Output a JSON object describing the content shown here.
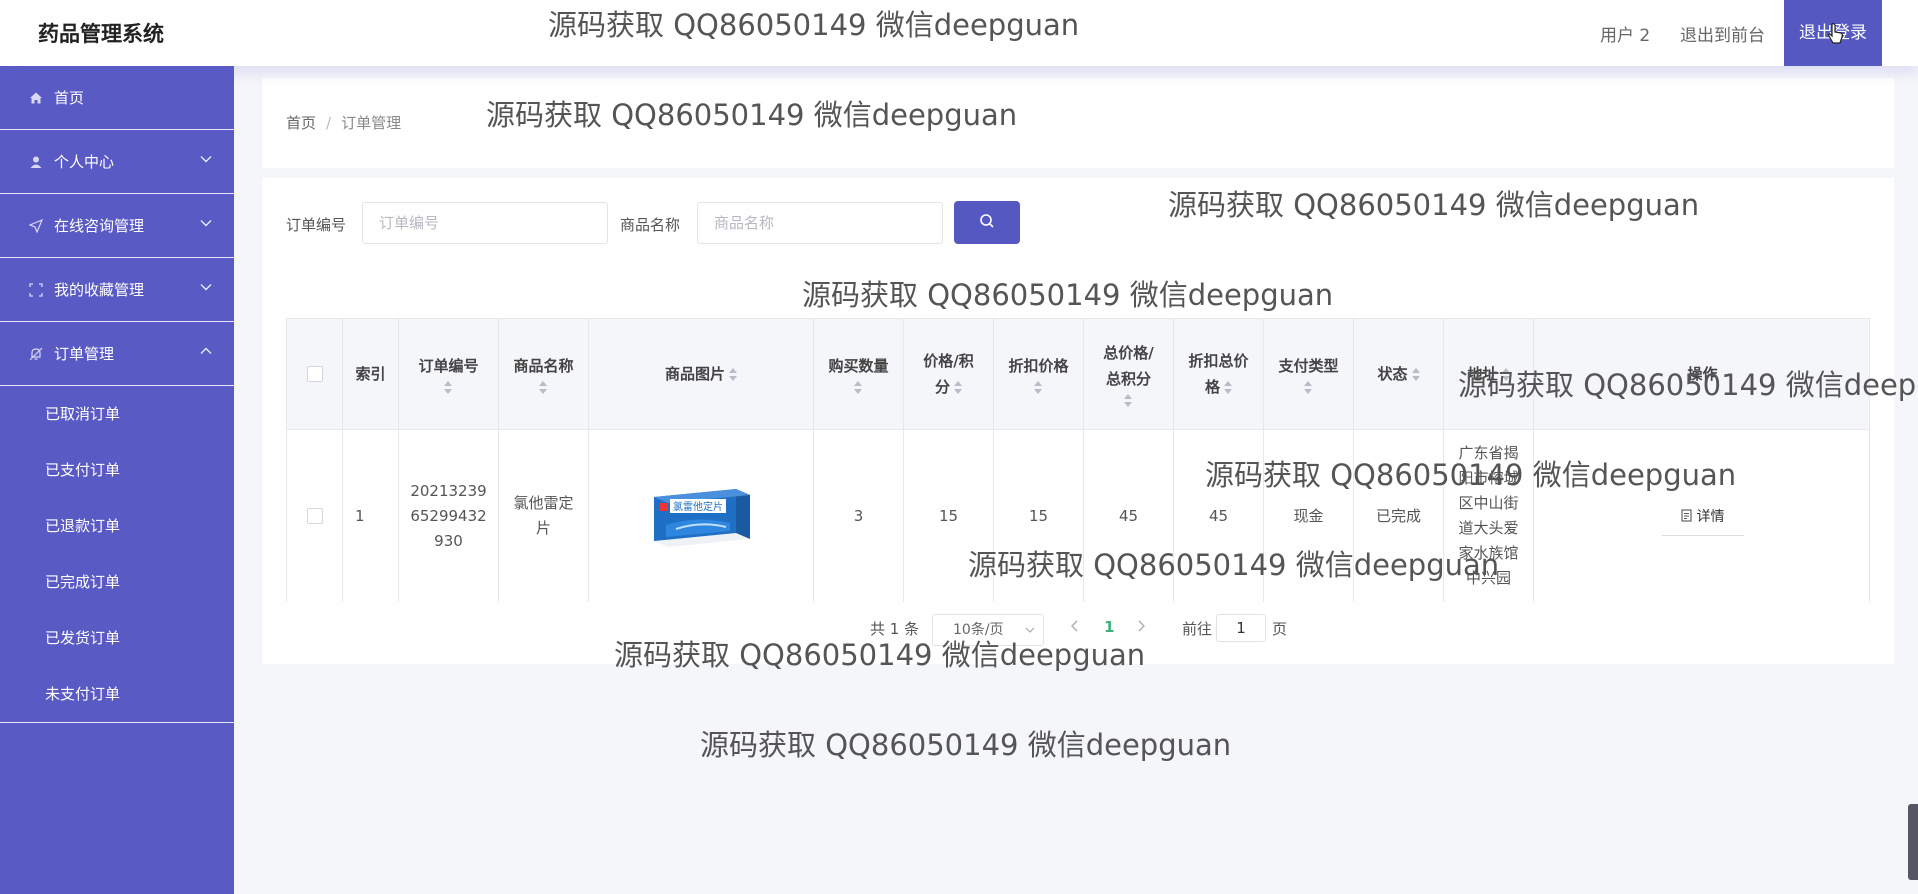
{
  "header": {
    "brand": "药品管理系统",
    "user": "用户 2",
    "front": "退出到前台",
    "logout": "退出登录"
  },
  "sidebar": {
    "items": [
      {
        "label": "首页",
        "icon": "home-icon"
      },
      {
        "label": "个人中心",
        "icon": "user-icon"
      },
      {
        "label": "在线咨询管理",
        "icon": "send-icon"
      },
      {
        "label": "我的收藏管理",
        "icon": "frame-icon"
      },
      {
        "label": "订单管理",
        "icon": "bell-off-icon"
      }
    ],
    "submenu": [
      "已取消订单",
      "已支付订单",
      "已退款订单",
      "已完成订单",
      "已发货订单",
      "未支付订单"
    ]
  },
  "breadcrumb": {
    "home": "首页",
    "sep": "/",
    "current": "订单管理"
  },
  "search": {
    "order_label": "订单编号",
    "order_placeholder": "订单编号",
    "product_label": "商品名称",
    "product_placeholder": "商品名称"
  },
  "table": {
    "headers": {
      "index": "索引",
      "order_no": "订单编号",
      "product": "商品名称",
      "image": "商品图片",
      "qty": "购买数量",
      "price_l1": "价格/积",
      "price_l2": "分",
      "discount": "折扣价格",
      "total_l1": "总价格/",
      "total_l2": "总积分",
      "disc_total_l1": "折扣总价",
      "disc_total_l2": "格",
      "pay_type": "支付类型",
      "status": "状态",
      "address": "地址",
      "action": "操作"
    },
    "row": {
      "index": "1",
      "order_no": [
        "20213239",
        "65299432",
        "930"
      ],
      "product": [
        "氯他雷定",
        "片"
      ],
      "image_label": "氯雷他定片",
      "qty": "3",
      "price": "15",
      "discount": "15",
      "total": "45",
      "disc_total": "45",
      "pay_type": "现金",
      "status": "已完成",
      "address": [
        "广东省揭",
        "阳市榕城",
        "区中山街",
        "道大头爱",
        "家水族馆",
        "中兴园"
      ],
      "detail": "详情"
    }
  },
  "pagination": {
    "total": "共 1 条",
    "page_size": "10条/页",
    "current": "1",
    "goto_prefix": "前往",
    "goto_value": "1",
    "goto_suffix": "页"
  },
  "watermark": "源码获取 QQ86050149 微信deepguan",
  "colors": {
    "sidebar": "#5a5ac4",
    "accent": "#5558c0",
    "page_active": "#3eb27a"
  }
}
